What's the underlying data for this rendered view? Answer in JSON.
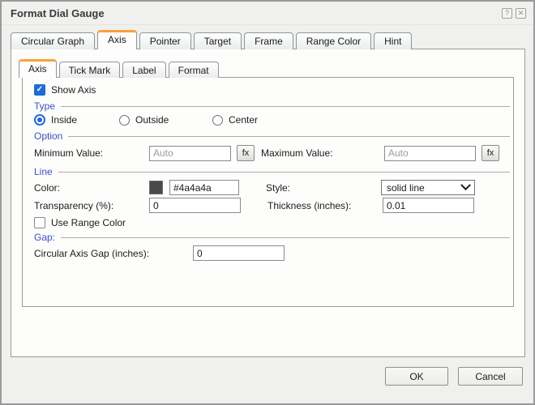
{
  "dialog": {
    "title": "Format Dial Gauge"
  },
  "icons": {
    "help": "?",
    "close": "✕",
    "check": "✓",
    "fx": "fx"
  },
  "tabs": [
    {
      "label": "Circular Graph",
      "active": false
    },
    {
      "label": "Axis",
      "active": true
    },
    {
      "label": "Pointer",
      "active": false
    },
    {
      "label": "Target",
      "active": false
    },
    {
      "label": "Frame",
      "active": false
    },
    {
      "label": "Range Color",
      "active": false
    },
    {
      "label": "Hint",
      "active": false
    }
  ],
  "subtabs": [
    {
      "label": "Axis",
      "active": true
    },
    {
      "label": "Tick Mark",
      "active": false
    },
    {
      "label": "Label",
      "active": false
    },
    {
      "label": "Format",
      "active": false
    }
  ],
  "form": {
    "show_axis": {
      "label": "Show Axis",
      "checked": true
    },
    "type_section": {
      "label": "Type",
      "options": [
        {
          "label": "Inside",
          "selected": true
        },
        {
          "label": "Outside",
          "selected": false
        },
        {
          "label": "Center",
          "selected": false
        }
      ]
    },
    "option_section": {
      "label": "Option",
      "minimum_value": {
        "label": "Minimum Value:",
        "placeholder": "Auto",
        "fx": "fx"
      },
      "maximum_value": {
        "label": "Maximum Value:",
        "placeholder": "Auto",
        "fx": "fx"
      }
    },
    "line_section": {
      "label": "Line",
      "color": {
        "label": "Color:",
        "swatch": "#4a4a4a",
        "value": "#4a4a4a"
      },
      "style": {
        "label": "Style:",
        "value": "solid line"
      },
      "transparency": {
        "label": "Transparency (%):",
        "value": "0"
      },
      "thickness": {
        "label": "Thickness (inches):",
        "value": "0.01"
      },
      "use_range_color": {
        "label": "Use Range Color",
        "checked": false
      }
    },
    "gap_section": {
      "label": "Gap:",
      "circular_axis_gap": {
        "label": "Circular Axis Gap (inches):",
        "value": "0"
      }
    }
  },
  "footer": {
    "ok_label": "OK",
    "cancel_label": "Cancel"
  },
  "colors": {
    "accent_orange": "#f9a13b",
    "section_label_blue": "#3b51c8",
    "control_blue": "#1f6bd8",
    "line_color_swatch": "#4a4a4a",
    "dialog_background": "#f0f0ee",
    "panel_background": "#fdfdfc"
  }
}
